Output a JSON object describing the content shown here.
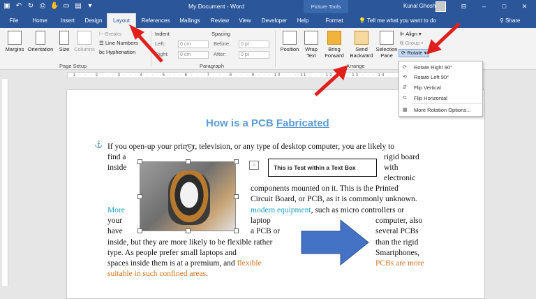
{
  "titlebar": {
    "document_title": "My Document - Word",
    "context_title": "Picture Tools",
    "user_name": "Kunal Ghosh"
  },
  "tabs": [
    "File",
    "Home",
    "Insert",
    "Design",
    "Layout",
    "References",
    "Mailings",
    "Review",
    "View",
    "Developer",
    "Help",
    "Format"
  ],
  "active_tab": "Layout",
  "tell_me": "Tell me what you want to do",
  "share": "Share",
  "ribbon": {
    "page_setup": {
      "margins": "Margins",
      "orientation": "Orientation",
      "size": "Size",
      "columns": "Columns",
      "breaks": "Breaks",
      "line_numbers": "Line Numbers",
      "hyphenation": "Hyphenation",
      "label": "Page Setup"
    },
    "paragraph": {
      "indent": "Indent",
      "spacing": "Spacing",
      "left": "Left:",
      "right": "Right:",
      "before": "Before:",
      "after": "After:",
      "left_value": "0 cm",
      "right_value": "0 cm",
      "before_value": "0 pt",
      "after_value": "0 pt",
      "label": "Paragraph"
    },
    "arrange": {
      "position": "Position",
      "wrap_text_1": "Wrap",
      "wrap_text_2": "Text",
      "bring_forward_1": "Bring",
      "bring_forward_2": "Forward",
      "send_backward_1": "Send",
      "send_backward_2": "Backward",
      "selection_pane_1": "Selection",
      "selection_pane_2": "Pane",
      "align": "Align",
      "group": "Group",
      "rotate": "Rotate",
      "label": "Arrange"
    }
  },
  "rotate_menu": {
    "items": [
      "Rotate Right 90°",
      "Rotate Left 90°",
      "Flip Vertical",
      "Flip Horizontal",
      "More Rotation Options..."
    ]
  },
  "document": {
    "heading_1": "How is a PCB ",
    "heading_2": "Fabricated",
    "textbox": "This is Test within a Text Box",
    "lines": {
      "l1": "If you open-up your printer, television, or any type of desktop computer, you are likely to",
      "l2a": "find a",
      "l2b": "rigid board",
      "l3a": "inside",
      "l3b": "with",
      "l4": "electronic",
      "l5": "components mounted on it. This is the Printed",
      "l6": "Circuit Board, or PCB, as it is commonly unknown.",
      "l7a": "More",
      "l7b": "modern equipment",
      "l7c": ", such as micro controllers or",
      "l8a": "your",
      "l8b": "laptop",
      "l8c": "computer, also",
      "l9a": "have",
      "l9b": "a PCB or",
      "l9c": "several PCBs",
      "l10a": "inside, but they are more likely to be flexible rather",
      "l10b": "than the rigid",
      "l11a": "type. As people prefer small laptops and",
      "l11b": "Smartphones,",
      "l12a": "spaces inside them is at a premium, and ",
      "l12b": "flexible",
      "l12c": "PCBs are more",
      "l13": "suitable in such confined areas",
      "l13b": "."
    }
  },
  "colors": {
    "ribbon_blue": "#2b579a",
    "annotation_red": "#e0201c",
    "shape_blue": "#4472c4",
    "link_blue": "#1ca0c9",
    "accent_orange": "#d6701a"
  }
}
